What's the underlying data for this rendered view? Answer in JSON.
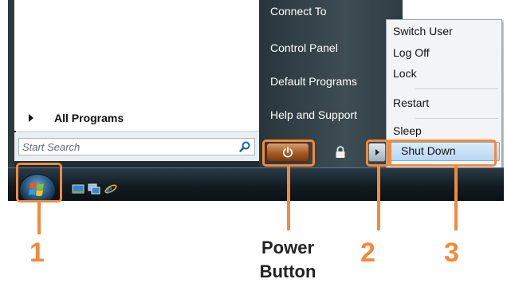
{
  "start_menu": {
    "all_programs_label": "All Programs",
    "search": {
      "placeholder": "Start Search"
    },
    "links": {
      "connect_to": "Connect To",
      "control_panel": "Control Panel",
      "default_programs": "Default Programs",
      "help_support": "Help and Support"
    }
  },
  "shutdown_menu": {
    "items": [
      "Switch User",
      "Log Off",
      "Lock",
      "Restart",
      "Sleep",
      "Shut Down"
    ],
    "highlighted": "Shut Down"
  },
  "annotations": {
    "one": "1",
    "two": "2",
    "three": "3",
    "power_line1": "Power",
    "power_line2": "Button"
  },
  "colors": {
    "annotation": "#f28a3b",
    "menu_dark": "#3e4c54",
    "highlight": "#b7d6f4"
  },
  "icons": [
    "power-icon",
    "lock-icon",
    "arrow-right-icon",
    "search-icon",
    "windows-orb-icon",
    "show-desktop-icon",
    "switch-windows-icon",
    "internet-explorer-icon"
  ]
}
